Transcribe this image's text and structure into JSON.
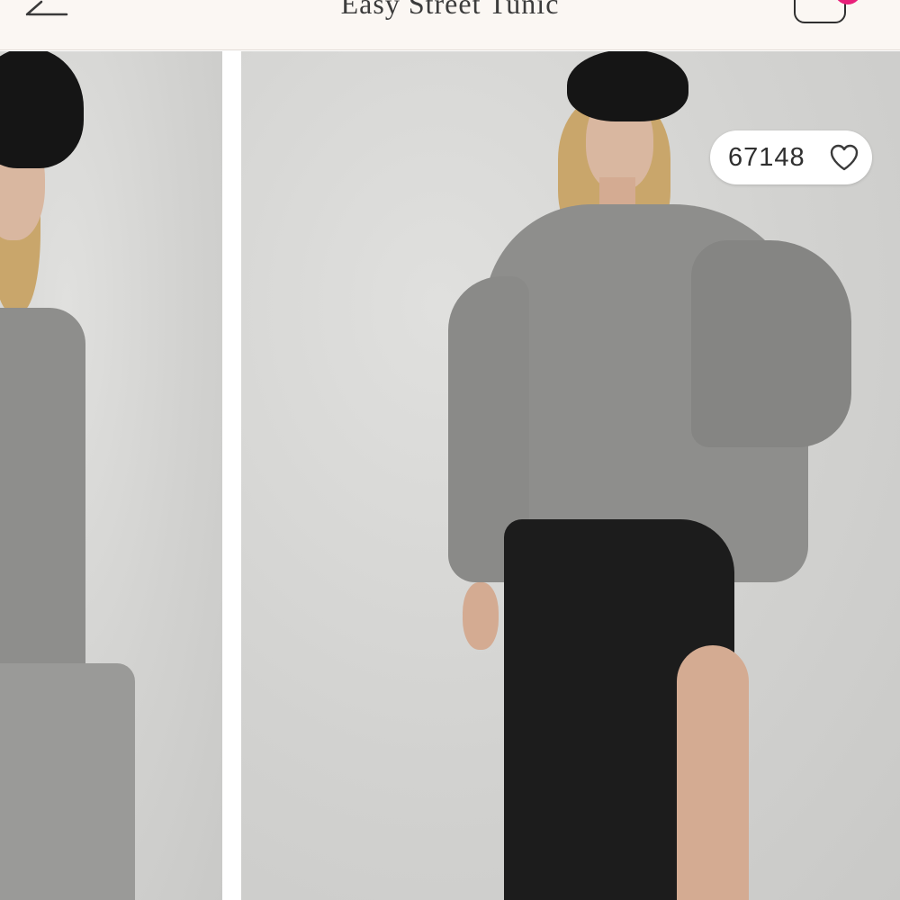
{
  "header": {
    "title": "Easy Street Tunic",
    "back_icon": "arrow-left-icon",
    "bag_icon": "shopping-bag-icon",
    "badge_color": "#e8207a"
  },
  "gallery": {
    "likes": {
      "count": "67148",
      "icon": "heart-outline-icon"
    }
  }
}
